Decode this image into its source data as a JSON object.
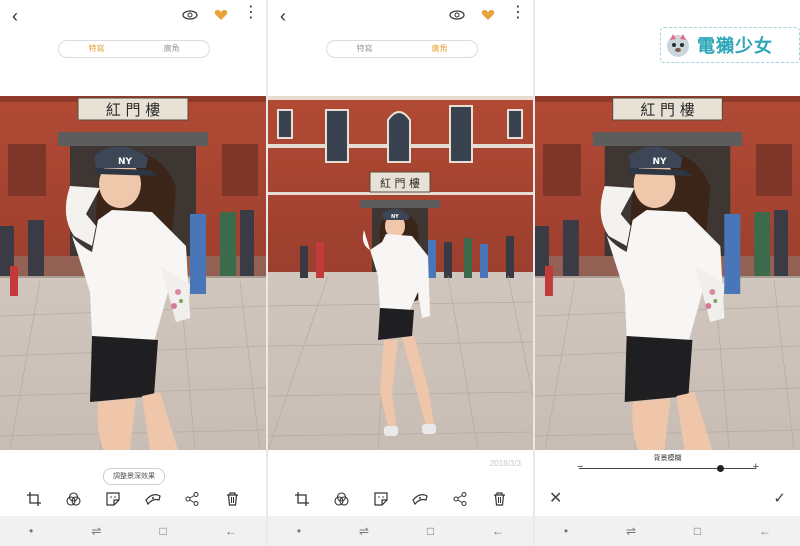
{
  "panels": [
    {
      "tabs": {
        "portrait": "特寫",
        "wide": "廣角"
      },
      "active_tab": "portrait",
      "adjust_chip": "調整景深效果",
      "tools": [
        "crop-icon",
        "filter-icon",
        "sticker-icon",
        "brush-icon",
        "share-icon",
        "delete-icon"
      ]
    },
    {
      "tabs": {
        "portrait": "特寫",
        "wide": "廣角"
      },
      "active_tab": "wide",
      "date_stamp": "2018/3/3",
      "tools": [
        "crop-icon",
        "filter-icon",
        "sticker-icon",
        "brush-icon",
        "share-icon",
        "delete-icon"
      ]
    },
    {
      "blur_label": "背景模糊",
      "minus": "−",
      "plus": "+",
      "blur_level": 0.8
    }
  ],
  "watermark": {
    "text": "電獺少女"
  },
  "nav": {
    "dot": "•",
    "recent": "⇌",
    "home": "□",
    "back": "←"
  },
  "colors": {
    "accent": "#e5a33b",
    "brick": "#b5533f",
    "watermark": "#2fa7b8"
  }
}
